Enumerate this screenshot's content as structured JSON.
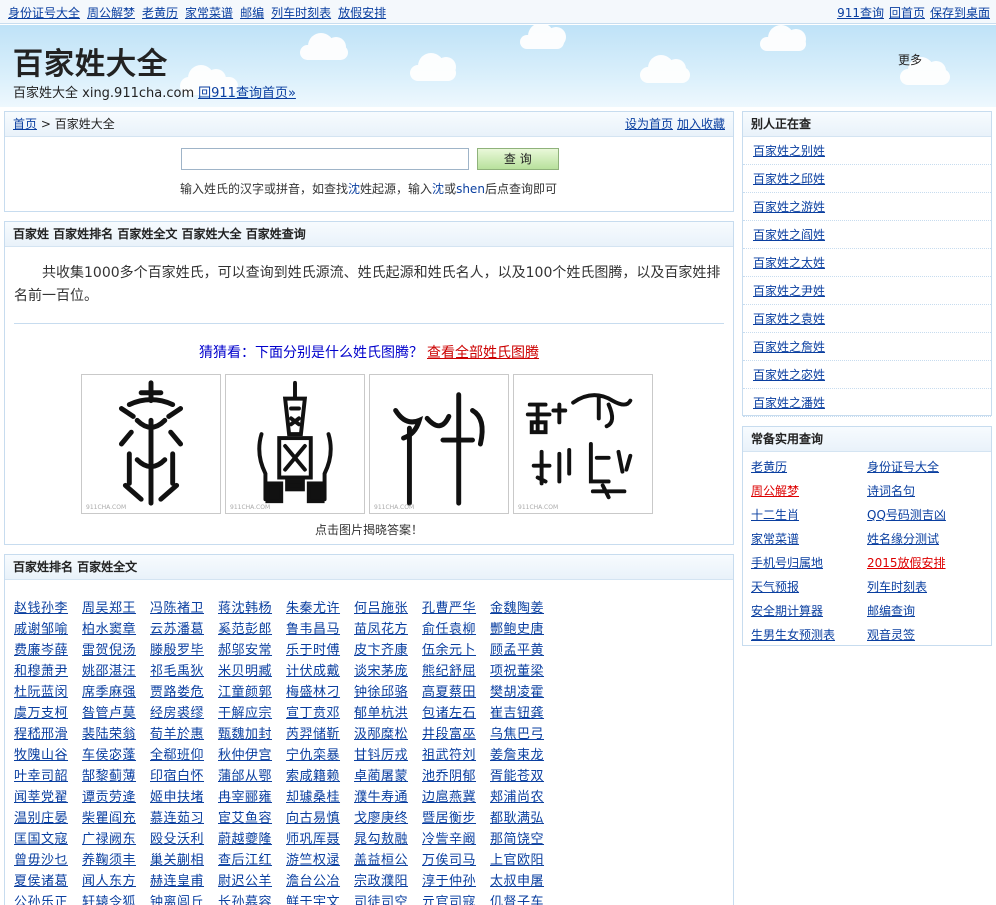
{
  "topbar": {
    "left_links": [
      "身份证号大全",
      "周公解梦",
      "老黄历",
      "家常菜谱",
      "邮编",
      "列车时刻表",
      "放假安排"
    ],
    "right_links": [
      "911查询",
      "回首页",
      "保存到桌面"
    ]
  },
  "header": {
    "title": "百家姓大全",
    "subtitle": "百家姓大全 xing.911cha.com",
    "home_link": "回911查询首页»",
    "more": "更多"
  },
  "breadcrumb": {
    "home": "首页",
    "sep": ">",
    "current": "百家姓大全",
    "set_home": "设为首页",
    "add_fav": "加入收藏"
  },
  "search": {
    "placeholder": "",
    "button": "查 询",
    "tip_a": "输入姓氏的汉字或拼音，如查找",
    "tip_char": "沈",
    "tip_b": "姓起源，输入",
    "tip_char2": "沈",
    "tip_or": "或",
    "tip_pinyin": "shen",
    "tip_c": "后点查询即可"
  },
  "intro_panel": {
    "heading": "百家姓 百家姓排名 百家姓全文 百家姓大全 百家姓查询",
    "text": "共收集1000多个百家姓氏，可以查询到姓氏源流、姓氏起源和姓氏名人，以及100个姓氏图腾，以及百家姓排名前一百位。",
    "guess": "猜猜看：下面分别是什么姓氏图腾？",
    "guess_link": "查看全部姓氏图腾",
    "hint": "点击图片揭晓答案！",
    "watermark": "911CHA.COM"
  },
  "names_panel": {
    "heading": "百家姓排名 百家姓全文",
    "rows": [
      [
        "赵钱孙李",
        "周吴郑王",
        "冯陈褚卫",
        "蒋沈韩杨",
        "朱秦尤许",
        "何吕施张",
        "孔曹严华",
        "金魏陶姜"
      ],
      [
        "戚谢邹喻",
        "柏水窦章",
        "云苏潘葛",
        "奚范彭郎",
        "鲁韦昌马",
        "苗凤花方",
        "俞任袁柳",
        "酆鲍史唐"
      ],
      [
        "费廉岑薛",
        "雷贺倪汤",
        "滕殷罗毕",
        "郝邬安常",
        "乐于时傅",
        "皮卞齐康",
        "伍余元卜",
        "顾孟平黄"
      ],
      [
        "和穆萧尹",
        "姚邵湛汪",
        "祁毛禹狄",
        "米贝明臧",
        "计伏成戴",
        "谈宋茅庞",
        "熊纪舒屈",
        "项祝董梁"
      ],
      [
        "杜阮蓝闵",
        "席季麻强",
        "贾路娄危",
        "江童颜郭",
        "梅盛林刁",
        "钟徐邱骆",
        "高夏蔡田",
        "樊胡凌霍"
      ],
      [
        "虞万支柯",
        "昝管卢莫",
        "经房裘缪",
        "干解应宗",
        "宣丁贲邓",
        "郁单杭洪",
        "包诸左石",
        "崔吉钮龚"
      ],
      [
        "程嵇邢滑",
        "裴陆荣翁",
        "荀羊於惠",
        "甄魏加封",
        "芮羿储靳",
        "汲邴糜松",
        "井段富巫",
        "乌焦巴弓"
      ],
      [
        "牧隗山谷",
        "车侯宓蓬",
        "全郗班仰",
        "秋仲伊宫",
        "宁仇栾暴",
        "甘钭厉戎",
        "祖武符刘",
        "姜詹束龙"
      ],
      [
        "叶幸司韶",
        "郜黎蓟薄",
        "印宿白怀",
        "蒲邰从鄂",
        "索咸籍赖",
        "卓蔺屠蒙",
        "池乔阴郁",
        "胥能苍双"
      ],
      [
        "闻莘党翟",
        "谭贡劳逄",
        "姬申扶堵",
        "冉宰郦雍",
        "却璩桑桂",
        "濮牛寿通",
        "边扈燕冀",
        "郏浦尚农"
      ],
      [
        "温别庄晏",
        "柴瞿阎充",
        "慕连茹习",
        "宦艾鱼容",
        "向古易慎",
        "戈廖庚终",
        "暨居衡步",
        "都耿满弘"
      ],
      [
        "匡国文寇",
        "广禄阙东",
        "殴殳沃利",
        "蔚越夔隆",
        "师巩厍聂",
        "晁勾敖融",
        "冷訾辛阚",
        "那简饶空"
      ],
      [
        "曾毋沙乜",
        "养鞠须丰",
        "巢关蒯相",
        "查后江红",
        "游竺权逯",
        "盖益桓公",
        "万俟司马",
        "上官欧阳"
      ],
      [
        "夏侯诸葛",
        "闻人东方",
        "赫连皇甫",
        "尉迟公羊",
        "澹台公冶",
        "宗政濮阳",
        "淳于仲孙",
        "太叔申屠"
      ],
      [
        "公孙乐正",
        "轩辕令狐",
        "钟离闾丘",
        "长孙慕容",
        "鲜于宇文",
        "司徒司空",
        "亓官司寇",
        "仉督子车"
      ]
    ]
  },
  "sidebar_recent": {
    "heading": "别人正在查",
    "items": [
      "百家姓之别姓",
      "百家姓之邱姓",
      "百家姓之游姓",
      "百家姓之阎姓",
      "百家姓之太姓",
      "百家姓之尹姓",
      "百家姓之袁姓",
      "百家姓之詹姓",
      "百家姓之宓姓",
      "百家姓之潘姓"
    ]
  },
  "sidebar_tools": {
    "heading": "常备实用查询",
    "items": [
      "老黄历",
      "身份证号大全",
      "周公解梦",
      "诗词名句",
      "十二生肖",
      "QQ号码测吉凶",
      "家常菜谱",
      "姓名缘分测试",
      "手机号归属地",
      "2015放假安排",
      "天气预报",
      "列车时刻表",
      "安全期计算器",
      "邮编查询",
      "生男生女预测表",
      "观音灵签"
    ],
    "red_items": [
      2,
      9
    ]
  },
  "colors": {
    "link": "#0a3fa0",
    "red": "#dd0000",
    "border": "#c7dcef",
    "header_sky": "#bfe2f7"
  }
}
